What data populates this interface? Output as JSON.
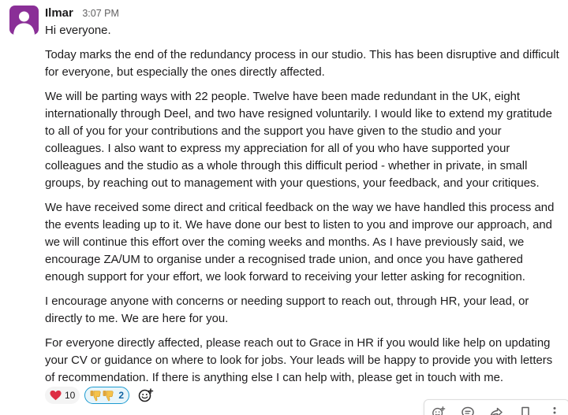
{
  "message": {
    "author": "Ilmar",
    "timestamp": "3:07 PM",
    "paragraphs": [
      "Hi everyone.",
      "Today marks the end of the redundancy process in our studio. This has been disruptive and difficult for everyone, but especially the ones directly affected.",
      "We will be parting ways with 22 people. Twelve have been made redundant in the UK, eight internationally through Deel, and two have resigned voluntarily. I would like to extend my gratitude to all of you for your contributions and the support you have given to the studio and your colleagues. I also want to express my appreciation for all of you who have supported your colleagues and the studio as a whole through this difficult period - whether in private, in small groups, by reaching out to management with your questions, your feedback, and your critiques.",
      "We have received some direct and critical feedback on the way we have handled this process and the events leading up to it. We have done our best to listen to you and improve our approach, and we will continue this effort over the coming weeks and months. As I have previously said, we encourage ZA/UM to organise under a recognised trade union, and once you have gathered enough support for your effort, we look forward to receiving your letter asking for recognition.",
      "I encourage anyone with concerns or needing support to reach out, through HR, your lead, or directly to me. We are here for you.",
      "For everyone directly affected, please reach out to Grace in HR if you would like help on updating your CV or guidance on where to look for jobs. Your leads will be happy to provide you with letters of recommendation. If there is anything else I can help with, please get in touch with me."
    ]
  },
  "reactions": [
    {
      "icon": "heart-emoji",
      "count": "10",
      "color": "#dd2e44"
    },
    {
      "icon": "thumbs-down-emoji",
      "count": "2",
      "color": "#f5c24a"
    }
  ],
  "icons": {
    "add_reaction": "add-reaction-icon",
    "toolbar": [
      "add-reaction-icon",
      "reply-in-thread-icon",
      "share-icon",
      "save-icon",
      "more-actions-icon"
    ]
  },
  "colors": {
    "avatar": "#8a2f97",
    "link_accent": "#1d9bd1",
    "text": "#1d1c1d",
    "muted": "#616061"
  }
}
